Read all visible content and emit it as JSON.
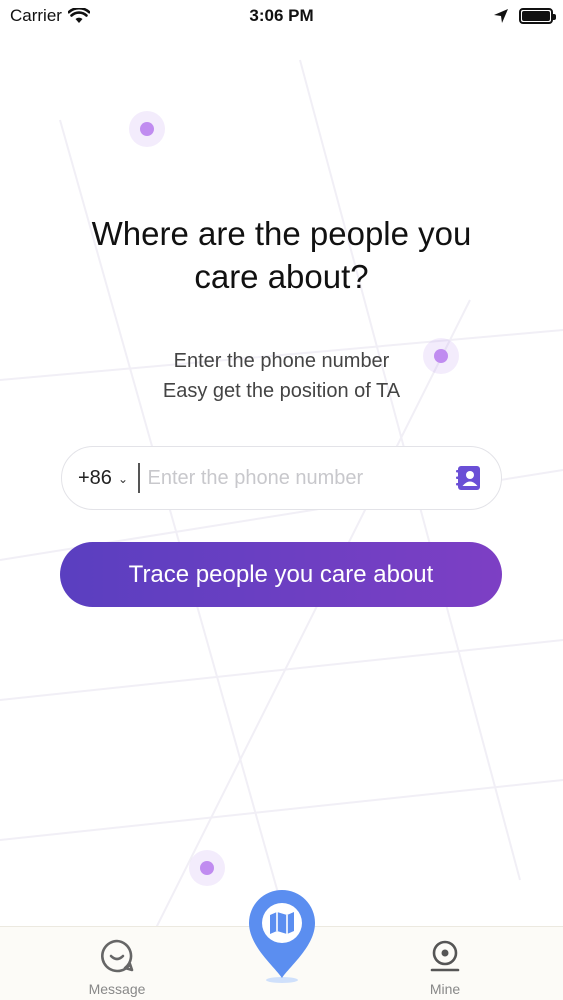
{
  "status_bar": {
    "carrier": "Carrier",
    "time": "3:06 PM"
  },
  "headline": {
    "line1": "Where are the people you",
    "line2": "care about?"
  },
  "subtitle": {
    "line1": "Enter the phone number",
    "line2": "Easy get the position of TA"
  },
  "phone_form": {
    "country_code": "+86",
    "placeholder": "Enter the phone number",
    "value": ""
  },
  "trace_button_label": "Trace people you care about",
  "tab_bar": {
    "message_label": "Message",
    "mine_label": "Mine"
  },
  "colors": {
    "accent_start": "#5a3fc0",
    "accent_end": "#7d3fc4",
    "contacts_icon": "#6a4fd6",
    "map_pin": "#5b8ef0",
    "dot": "#c08cf0"
  },
  "icons": {
    "wifi": "wifi-icon",
    "location": "location-arrow-icon",
    "battery": "battery-icon",
    "contacts": "contacts-book-icon",
    "message": "smile-chat-icon",
    "map": "map-pin-icon",
    "mine": "profile-icon"
  }
}
